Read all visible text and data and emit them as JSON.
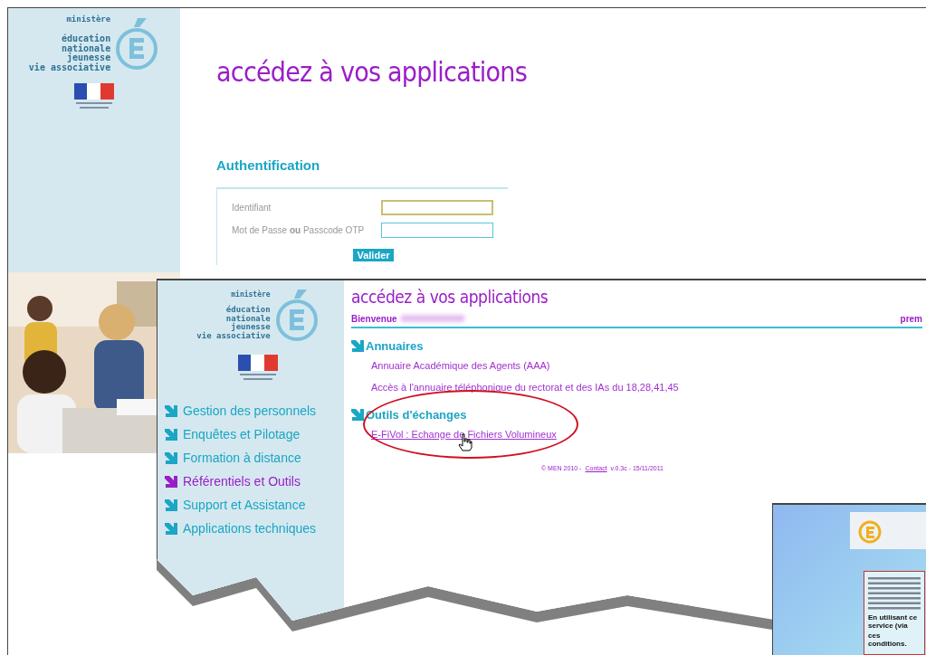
{
  "back_window": {
    "logo": {
      "ministry": "ministère",
      "lines": [
        "éducation",
        "nationale",
        "jeunesse",
        "vie associative"
      ]
    },
    "title": "accédez à vos applications",
    "auth": {
      "heading": "Authentification",
      "fields": [
        {
          "label": "Identifiant",
          "focused": true
        },
        {
          "label": "Mot de Passe **ou** Passcode OTP",
          "focused": false
        }
      ],
      "submit": "Valider"
    }
  },
  "front_window": {
    "logo": {
      "ministry": "ministère",
      "lines": [
        "éducation",
        "nationale",
        "jeunesse",
        "vie associative"
      ]
    },
    "menu": [
      {
        "label": "Gestion des personnels",
        "selected": false
      },
      {
        "label": "Enquêtes et Pilotage",
        "selected": false
      },
      {
        "label": "Formation à distance",
        "selected": false
      },
      {
        "label": "Référentiels et Outils",
        "selected": true
      },
      {
        "label": "Support et Assistance",
        "selected": false
      },
      {
        "label": "Applications techniques",
        "selected": false
      }
    ],
    "title": "accédez à vos applications",
    "welcome": "Bienvenue",
    "right_text": "prem",
    "sections": [
      {
        "heading": "Annuaires",
        "links": [
          {
            "label": "Annuaire Académique des Agents (AAA)",
            "hovered": false
          },
          {
            "label": "Accès à l'annuaire téléphonique du rectorat et des IAs du 18,28,41,45",
            "hovered": false
          }
        ]
      },
      {
        "heading": "Outils d'échanges",
        "links": [
          {
            "label": "E-FiVol : Echange de Fichiers Volumineux",
            "hovered": true
          }
        ]
      }
    ],
    "footer": {
      "before": "© MEN 2010 -",
      "contact": "Contact",
      "after": "v.0.3c - 15/11/2011"
    }
  },
  "third_window": {
    "notice": [
      "En utilisant ce service (via",
      "ces conditions."
    ]
  }
}
